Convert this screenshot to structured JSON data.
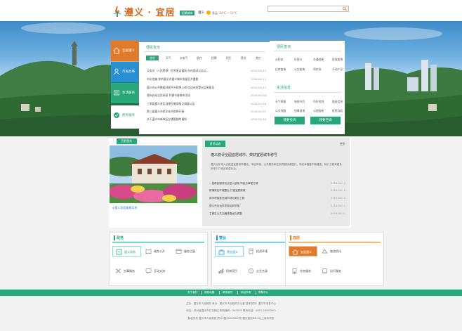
{
  "header": {
    "logo_text": "遵义 · 宜居",
    "city_switch_label": "切换城市",
    "city_name": "遵义",
    "weather": "多云",
    "temperature": "20°C ~ 14°C",
    "search_placeholder": ""
  },
  "left_nav": [
    {
      "label": "宜居遵义",
      "color": "#e07b2c"
    },
    {
      "label": "市民办事",
      "color": "#2a8fd0"
    },
    {
      "label": "生活服务",
      "color": "#2aa77a"
    },
    {
      "label": "便民服务",
      "color": "#ffffff"
    }
  ],
  "notice": {
    "title": "便民告示",
    "tabs": [
      "综合",
      "天气",
      "水电气",
      "医疗",
      "招聘",
      "招生",
      "营业",
      "其它"
    ],
    "rows": [
      {
        "text": "公务员（人民警察）招考笔试通知 市内面试公告公...",
        "date": "2016-04-12"
      },
      {
        "text": "市长信箱 你的意见对遵义城市发展至关重要",
        "date": "2016-04-11"
      },
      {
        "text": "遵义市公共数据开放平台即将上线 欢迎市民提出宝贵意见",
        "date": "2016-04-11"
      },
      {
        "text": "我市启动全民阅读 共建书香城市活动",
        "date": "2016-04-08"
      },
      {
        "text": "三季度遵义各区县便民服务网点调整公告",
        "date": "2016-04-08"
      },
      {
        "text": "第三届遵义市民文化节即将开幕",
        "date": "2016-04-02"
      },
      {
        "text": "关于遵义市新城区交通管制的通知",
        "date": "2016-01-29"
      }
    ]
  },
  "convenience": {
    "title": "便民查询",
    "items": [
      "公积金",
      "社保卡",
      "交通违章",
      "医保查询",
      "住房查询",
      "公交查询",
      "停车场",
      "不动产证"
    ],
    "life_title": "生活信息",
    "life_items": [
      "天气预报",
      "电视节目",
      "列车时刻",
      "航班信息",
      "公交线路",
      "违章查询",
      "公园指南",
      "医院导航"
    ],
    "btn_service": "我要投诉",
    "btn_consult": "我要咨询"
  },
  "photo": {
    "tab": "百姓图片",
    "caption": "遵义宜居美景实拍"
  },
  "news": {
    "tab": "资讯动态",
    "more": "更多",
    "headline": "遵义获评全国宜居城市，荣获宜居城市称号",
    "desc": "遵义近年来大力推进宜居城市建设，市区环境、公共服务和生态质量持续提升，市民幸福感不断增强，吸引了越来越多外来人口来此安居乐业。",
    "rows": [
      {
        "text": "一批便民服务站点投入使用 市民办事更方便",
        "date": "2016-04-12"
      },
      {
        "text": "新蒲新区环境整治 打造宜居新城",
        "date": "2016-04-12"
      },
      {
        "text": "我市积极推进城市绿化美化工程",
        "date": "2016-04-12"
      },
      {
        "text": "遵义市出台多项惠民新举措",
        "date": "2016-04-11"
      },
      {
        "text": "主城区公共交通线路优化调整",
        "date": "2016-04-11"
      }
    ]
  },
  "services": [
    {
      "title": "政务",
      "color": "#2aa77a",
      "items": [
        "遵义导航",
        "政务公开",
        "服务之窗",
        "办事服务",
        "互动交流"
      ]
    },
    {
      "title": "营业",
      "color": "#2a8fd0",
      "items": [
        "营业遵义",
        "投资环境",
        "招商项目",
        "企业名录"
      ]
    },
    {
      "title": "宜居",
      "color": "#e07b2c",
      "items": [
        "宜居遵义",
        "旅游资讯",
        "住房服务",
        "出行服务"
      ]
    }
  ],
  "footer": {
    "links": [
      "关于我们",
      "网站地图",
      "联系我们",
      "网站声明",
      "帮助中心"
    ],
    "line1": "主办：遵义市人民政府  承办：遵义市人民政府办公室  技术支持：遵义市信息中心",
    "line2": "地址：贵州省遵义市红花岗区  邮政编码：563000  联系电话：0851-28000000",
    "line3": "版权所有 遵义市人民政府  黔ICP备00000000号  建议使用IE8.0以上版本浏览"
  },
  "colors": {
    "accent": "#2aa77a",
    "orange": "#e07b2c",
    "blue": "#2a8fd0"
  }
}
